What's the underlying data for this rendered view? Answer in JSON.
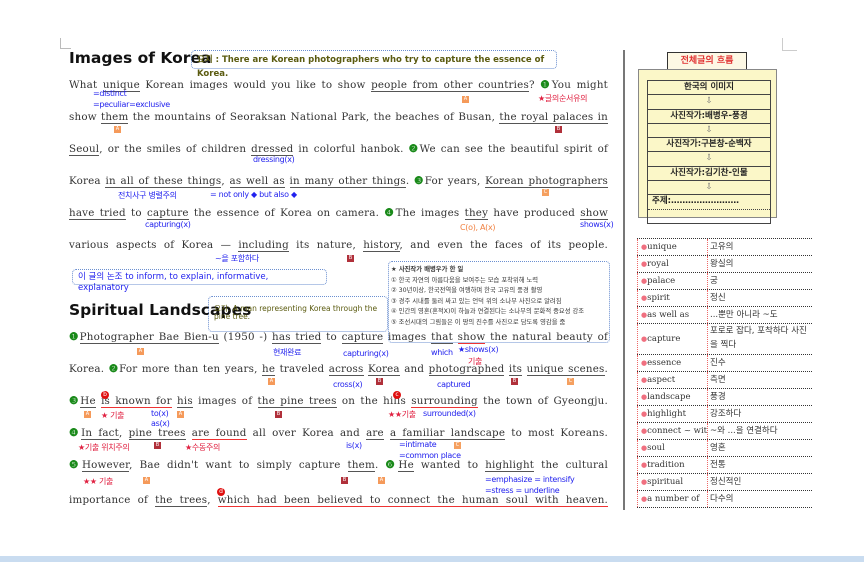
{
  "section1": {
    "title": "Images of Korea",
    "summary": "요지 : There are Korean photographers who try to capture the essence of Korea.",
    "lines": [
      [
        {
          "t": "What "
        },
        {
          "t": "unique",
          "u": true
        },
        {
          "t": " Korean images would you like to show "
        },
        {
          "t": "people from other countries",
          "u": true
        },
        {
          "t": "? "
        },
        {
          "t": "❶",
          "n": true
        },
        {
          "t": "You might"
        }
      ],
      [
        {
          "t": "show "
        },
        {
          "t": "them",
          "u": true
        },
        {
          "t": " the mountains of Seoraksan National Park, the beaches of Busan, "
        },
        {
          "t": "the royal palaces in",
          "u": true
        }
      ],
      [
        {
          "t": "Seoul",
          "u": true
        },
        {
          "t": ", or the smiles of children "
        },
        {
          "t": "dressed",
          "u": true
        },
        {
          "t": " in colorful hanbok. "
        },
        {
          "t": "❷",
          "n": true
        },
        {
          "t": "We can see the beautiful spirit of"
        }
      ],
      [
        {
          "t": "Korea "
        },
        {
          "t": "in all of these things",
          "u": true
        },
        {
          "t": ", "
        },
        {
          "t": "as well as",
          "u": true
        },
        {
          "t": " "
        },
        {
          "t": "in many other things",
          "u": true
        },
        {
          "t": ". "
        },
        {
          "t": "❸",
          "n": true
        },
        {
          "t": "For years, "
        },
        {
          "t": "Korean photographers",
          "u": true
        }
      ],
      [
        {
          "t": "have tried",
          "u": true
        },
        {
          "t": " to "
        },
        {
          "t": "capture",
          "u": true
        },
        {
          "t": " the essence of Korea on camera. "
        },
        {
          "t": "❹",
          "n": true
        },
        {
          "t": "The images "
        },
        {
          "t": "they",
          "u": true
        },
        {
          "t": " have produced "
        },
        {
          "t": "show",
          "u": true
        }
      ],
      [
        {
          "t": "various aspects of Korea — "
        },
        {
          "t": "including",
          "u": true
        },
        {
          "t": " its nature, "
        },
        {
          "t": "history",
          "u": true
        },
        {
          "t": ", and even the faces of its people."
        }
      ]
    ],
    "annotations": {
      "distinct": "=distinct",
      "peculiar": "=peculiar=exclusive",
      "order_note": "★글의순서유의",
      "dressing": "dressing(x)",
      "parallel": "전치사구 병렬주의",
      "not_only": "= not only ◆ but also ◆",
      "capturing": "capturing(x)",
      "they_note": "C(o), A(x)",
      "shows": "shows(x)",
      "including": "~을 포함하다"
    },
    "tone_note": "이 글의 논조 to inform, to explain, informative, explanatory"
  },
  "bae_box": {
    "title": "★ 사진작가 배병우가 한 일",
    "items": [
      "① 한국 자연의 아름다움을 보여주는 모습 포착위해 노력",
      "② 30년이상, 한국전역을 여행하며 한국 고유의 풍경 촬영",
      "③ 경주 시내를 둘러 싸고 있는 언덕 위의 소나무 사진으로 알려짐",
      "④ 인간의 영혼(혼적X)이 하늘과 연결된다는 소나무의 문화적 중요성 강조",
      "⑤ 조선시대의 그림들은 이 땅의 진수를 사진으로 담도록 영감을 줌"
    ]
  },
  "section2": {
    "title": "Spiritual Landscapes",
    "summary": "요지:  A man representing Korea through the pine tree.",
    "lines": [
      [
        {
          "t": "❶",
          "n": true
        },
        {
          "t": "Photographer Bae Bien-u",
          "u": true
        },
        {
          "t": " (1950 -) "
        },
        {
          "t": "has tried",
          "u": true
        },
        {
          "t": " to "
        },
        {
          "t": "capture",
          "u": true
        },
        {
          "t": " images "
        },
        {
          "t": "that",
          "u": true
        },
        {
          "t": " "
        },
        {
          "t": "show",
          "r": true
        },
        {
          "t": " the natural beauty of"
        }
      ],
      [
        {
          "t": "Korea. "
        },
        {
          "t": "❷",
          "n": true
        },
        {
          "t": "For more than ten years, "
        },
        {
          "t": "he",
          "u": true
        },
        {
          "t": " traveled "
        },
        {
          "t": "across",
          "u": true
        },
        {
          "t": " "
        },
        {
          "t": "Korea",
          "u": true
        },
        {
          "t": " and "
        },
        {
          "t": "photographed",
          "u": true
        },
        {
          "t": " "
        },
        {
          "t": "its",
          "u": true
        },
        {
          "t": " "
        },
        {
          "t": "unique scenes",
          "u": true
        },
        {
          "t": "."
        }
      ],
      [
        {
          "t": "❸",
          "n": true
        },
        {
          "t": "He",
          "u": true
        },
        {
          "t": " "
        },
        {
          "t": "is known for",
          "r": true
        },
        {
          "t": " "
        },
        {
          "t": "his",
          "u": true
        },
        {
          "t": " images of "
        },
        {
          "t": "the pine trees",
          "u": true
        },
        {
          "t": " on the hills "
        },
        {
          "t": "surrounding",
          "r": true
        },
        {
          "t": " the town of Gyeongju."
        }
      ],
      [
        {
          "t": "❹",
          "n": true
        },
        {
          "t": "In fact",
          "u": true
        },
        {
          "t": ", "
        },
        {
          "t": "pine trees",
          "u": true
        },
        {
          "t": " "
        },
        {
          "t": "are found",
          "r": true
        },
        {
          "t": " all over Korea and "
        },
        {
          "t": "are",
          "u": true
        },
        {
          "t": " "
        },
        {
          "t": "a familiar landscape",
          "u": true
        },
        {
          "t": " to most Koreans."
        }
      ],
      [
        {
          "t": "❺",
          "n": true
        },
        {
          "t": "However",
          "u": true
        },
        {
          "t": ", Bae didn't want to simply capture "
        },
        {
          "t": "them",
          "u": true
        },
        {
          "t": ". "
        },
        {
          "t": "❻",
          "n": true
        },
        {
          "t": "He",
          "u": true
        },
        {
          "t": " wanted to "
        },
        {
          "t": "highlight",
          "u": true
        },
        {
          "t": " the cultural"
        }
      ],
      [
        {
          "t": "importance of "
        },
        {
          "t": "the trees",
          "u": true
        },
        {
          "t": ", "
        },
        {
          "t": "which had been believed to connect the human soul with heaven.",
          "r": true
        }
      ]
    ],
    "annotations": {
      "present_perfect": "현재완료",
      "capturing": "capturing(x)",
      "which": "which",
      "shows": "★shows(x)",
      "exam1": "기출",
      "cross": "cross(x)",
      "captured": "captured",
      "exam_star": "★ 기출",
      "to": "to(x)",
      "as": "as(x)",
      "exam_2star": "★★기출",
      "surrounded": "surrounded(x)",
      "position": "★기출 위치주의",
      "passive": "★수동주의",
      "is": "is(x)",
      "intimate": "=intimate",
      "common_place": "=common place",
      "exam_2star_b": "★★ 기출",
      "emphasize": "=emphasize  =  intensify",
      "stress": "=stress        =  underline"
    }
  },
  "markers": {
    "a": "A",
    "b": "B",
    "c": "C",
    "b_circle": "b",
    "c_circle": "c",
    "d_circle": "d"
  },
  "flow": {
    "tab": "전체글의 흐름",
    "rows": [
      "한국의 이미지",
      "⇩",
      "사진작가:배병우-풍경",
      "⇩",
      "사진작가:구본창-순백자",
      "⇩",
      "사진작가:김기찬-인물",
      "⇩",
      "주제:……………………",
      ""
    ]
  },
  "vocab": [
    {
      "en": "unique",
      "ko": "고유의"
    },
    {
      "en": "royal",
      "ko": "왕실의"
    },
    {
      "en": "palace",
      "ko": "궁"
    },
    {
      "en": "spirit",
      "ko": "정신"
    },
    {
      "en": "as well as",
      "ko": "...뿐만 아니라 ~도"
    },
    {
      "en": "capture",
      "ko": "포로로 잡다, 포착하다 사진을 찍다"
    },
    {
      "en": "essence",
      "ko": "진수"
    },
    {
      "en": "aspect",
      "ko": "측면"
    },
    {
      "en": "landscape",
      "ko": "풍경"
    },
    {
      "en": "highlight",
      "ko": "강조하다"
    },
    {
      "en": "connect ~ with",
      "ko": "~와 ...을 연결하다"
    },
    {
      "en": "soul",
      "ko": "영혼"
    },
    {
      "en": "tradition",
      "ko": "전통"
    },
    {
      "en": "spiritual",
      "ko": "정신적인"
    },
    {
      "en": "a number of",
      "ko": "다수의"
    }
  ],
  "colors": {
    "accent_blue": "#2222ee",
    "accent_red": "#e02040",
    "number_green": "#1a8a1a",
    "flow_bg": "#fbf7c8"
  }
}
